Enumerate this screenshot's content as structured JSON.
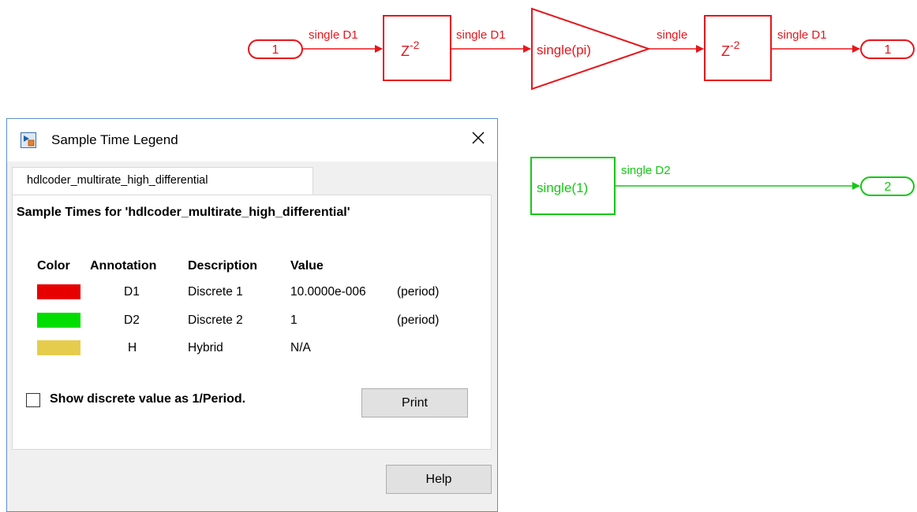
{
  "model": {
    "red_color": "#e8151b",
    "green_color": "#14c814",
    "inport_1": "1",
    "outport_1": "1",
    "inport_label_top": "single D1",
    "delay1_signal_out": "single D1",
    "gain_signal_out": "single",
    "delay2_signal_out": "single D1",
    "delay_base": "Z",
    "delay_exp": "-2",
    "gain_label": "single(pi)",
    "const_label": "single(1)",
    "const_signal_out": "single D2",
    "outport_2": "2"
  },
  "dialog": {
    "title": "Sample Time Legend",
    "title_icon": "simulink-app-icon",
    "close_icon": "close-icon",
    "tab_label": "hdlcoder_multirate_high_differential",
    "heading": "Sample Times for 'hdlcoder_multirate_high_differential'",
    "columns": [
      "Color",
      "Annotation",
      "Description",
      "Value"
    ],
    "rows": [
      {
        "color": "#e60000",
        "annotation": "D1",
        "description": "Discrete 1",
        "value": "10.0000e-006",
        "type": "(period)"
      },
      {
        "color": "#00dd00",
        "annotation": "D2",
        "description": "Discrete 2",
        "value": "1",
        "type": "(period)"
      },
      {
        "color": "#e6cc4d",
        "annotation": "H",
        "description": "Hybrid",
        "value": "N/A",
        "type": ""
      }
    ],
    "checkbox_label": "Show discrete value as 1/Period.",
    "checkbox_checked": false,
    "print_label": "Print",
    "help_label": "Help"
  }
}
